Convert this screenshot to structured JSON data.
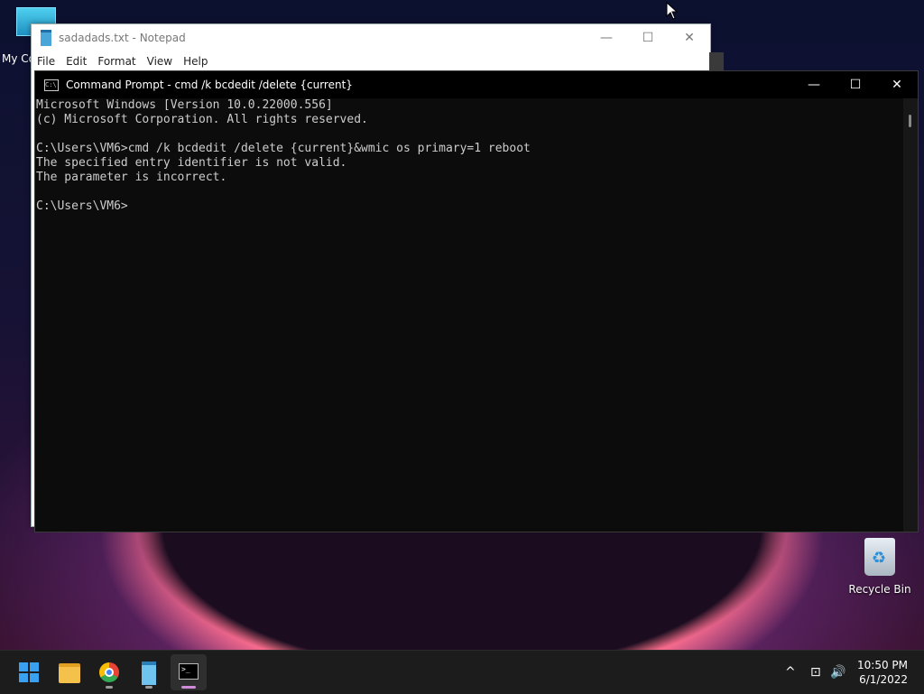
{
  "desktop": {
    "icons": [
      {
        "label": "My Co"
      },
      {
        "label": "Recycle Bin"
      }
    ]
  },
  "notepad": {
    "title": "sadadads.txt - Notepad",
    "menu": [
      "File",
      "Edit",
      "Format",
      "View",
      "Help"
    ],
    "controls": {
      "minimize": "—",
      "maximize": "☐",
      "close": "✕"
    }
  },
  "cmd": {
    "title": "Command Prompt - cmd  /k bcdedit /delete {current}",
    "controls": {
      "minimize": "—",
      "maximize": "☐",
      "close": "✕"
    },
    "lines": [
      "Microsoft Windows [Version 10.0.22000.556]",
      "(c) Microsoft Corporation. All rights reserved.",
      "",
      "C:\\Users\\VM6>cmd /k bcdedit /delete {current}&wmic os primary=1 reboot",
      "The specified entry identifier is not valid.",
      "The parameter is incorrect.",
      "",
      "C:\\Users\\VM6>"
    ]
  },
  "taskbar": {
    "apps": [
      {
        "name": "start",
        "icon": "windows-logo-icon"
      },
      {
        "name": "file-explorer",
        "icon": "folder-icon"
      },
      {
        "name": "chrome",
        "icon": "chrome-icon"
      },
      {
        "name": "notepad",
        "icon": "notepad-icon"
      },
      {
        "name": "command-prompt",
        "icon": "terminal-icon"
      }
    ],
    "tray": {
      "chevron": "^",
      "network": "⊡",
      "volume": "🔊"
    },
    "time": "10:50 PM",
    "date": "6/1/2022"
  }
}
